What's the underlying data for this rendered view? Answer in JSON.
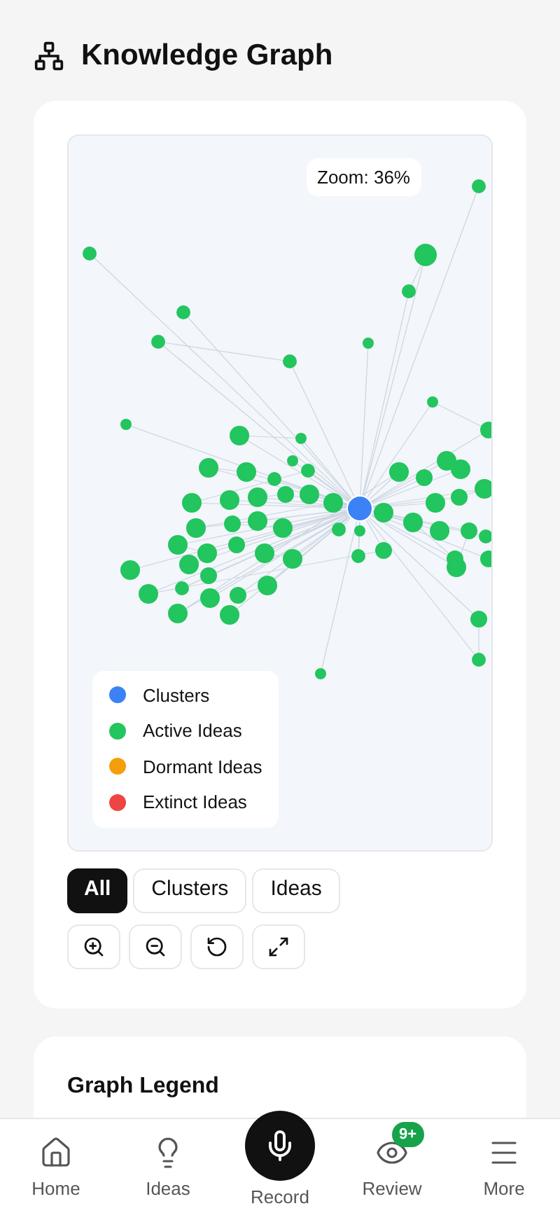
{
  "header": {
    "title": "Knowledge Graph"
  },
  "graph": {
    "zoom_label": "Zoom: 36%",
    "legend": [
      {
        "label": "Clusters",
        "color": "#3b82f6"
      },
      {
        "label": "Active Ideas",
        "color": "#22c55e"
      },
      {
        "label": "Dormant Ideas",
        "color": "#f59e0b"
      },
      {
        "label": "Extinct Ideas",
        "color": "#ef4444"
      }
    ]
  },
  "filters": [
    {
      "label": "All",
      "selected": true
    },
    {
      "label": "Clusters",
      "selected": false
    },
    {
      "label": "Ideas",
      "selected": false
    }
  ],
  "legend_card": {
    "title": "Graph Legend"
  },
  "nav": [
    {
      "kind": "tab",
      "label": "Home"
    },
    {
      "kind": "tab",
      "label": "Ideas"
    },
    {
      "kind": "record",
      "label": "Record"
    },
    {
      "kind": "tab",
      "label": "Review",
      "badge": "9+"
    },
    {
      "kind": "tab",
      "label": "More"
    }
  ]
}
